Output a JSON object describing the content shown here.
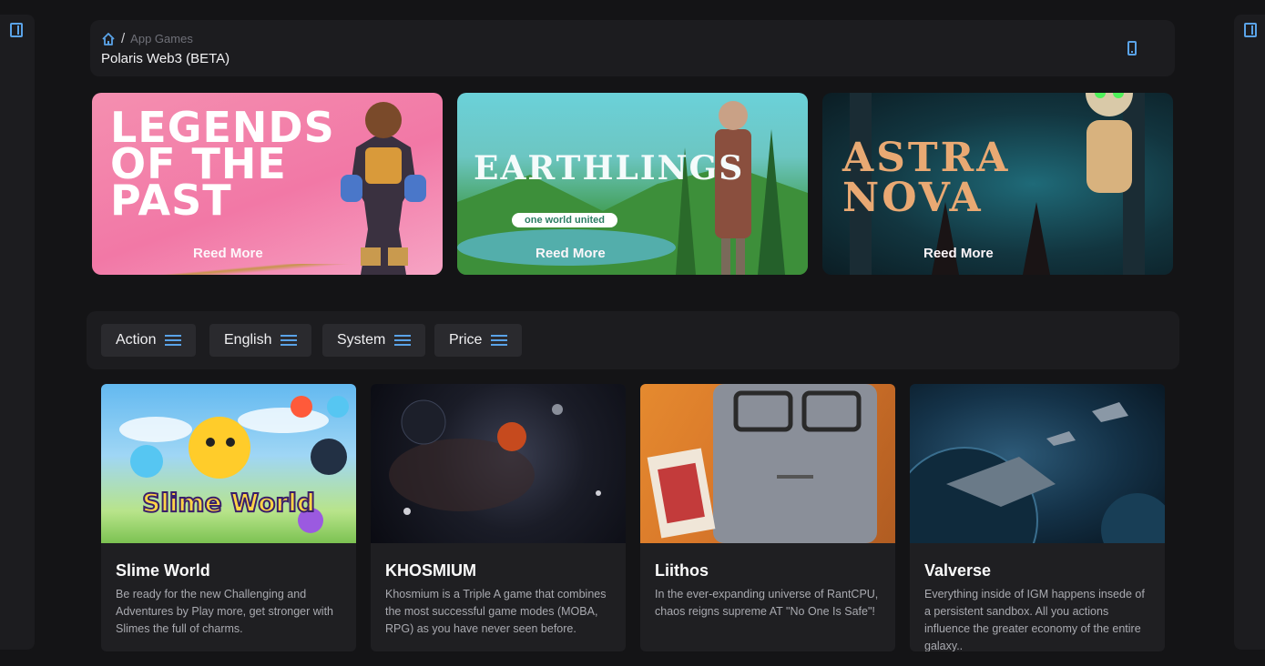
{
  "breadcrumb": {
    "sep": "/",
    "path": "App Games",
    "title": "Polaris Web3 (BETA)"
  },
  "heroes": [
    {
      "title": "LEGENDS OF THE PAST",
      "cta": "Reed More"
    },
    {
      "title": "EARTHLINGS",
      "subtitle": "one world united",
      "cta": "Reed More"
    },
    {
      "title": "ASTRA NOVA",
      "cta": "Reed More"
    }
  ],
  "filters": [
    {
      "label": "Action"
    },
    {
      "label": "English"
    },
    {
      "label": "System"
    },
    {
      "label": "Price"
    }
  ],
  "games": [
    {
      "title": "Slime World",
      "image_text": "Slime World",
      "description": "Be ready for the new Challenging and Adventures by Play more, get stronger with Slimes the full of charms."
    },
    {
      "title": "KHOSMIUM",
      "description": "Khosmium is a Triple A game that combines the most successful game modes (MOBA, RPG) as you have never seen before."
    },
    {
      "title": "Liithos",
      "description": "In the ever-expanding universe of RantCPU, chaos reigns supreme AT \"No One Is Safe\"!"
    },
    {
      "title": "Valverse",
      "description": "Everything inside of IGM happens insede of a persistent sandbox. All you actions influence the greater economy of the entire galaxy.."
    }
  ],
  "colors": {
    "accent": "#5aa3e8",
    "background": "#141416",
    "panel": "#1c1c1f"
  },
  "icons": {
    "sidebar_toggle": "panel-icon",
    "home": "home-icon",
    "device": "phone-icon",
    "filter": "menu-icon"
  }
}
